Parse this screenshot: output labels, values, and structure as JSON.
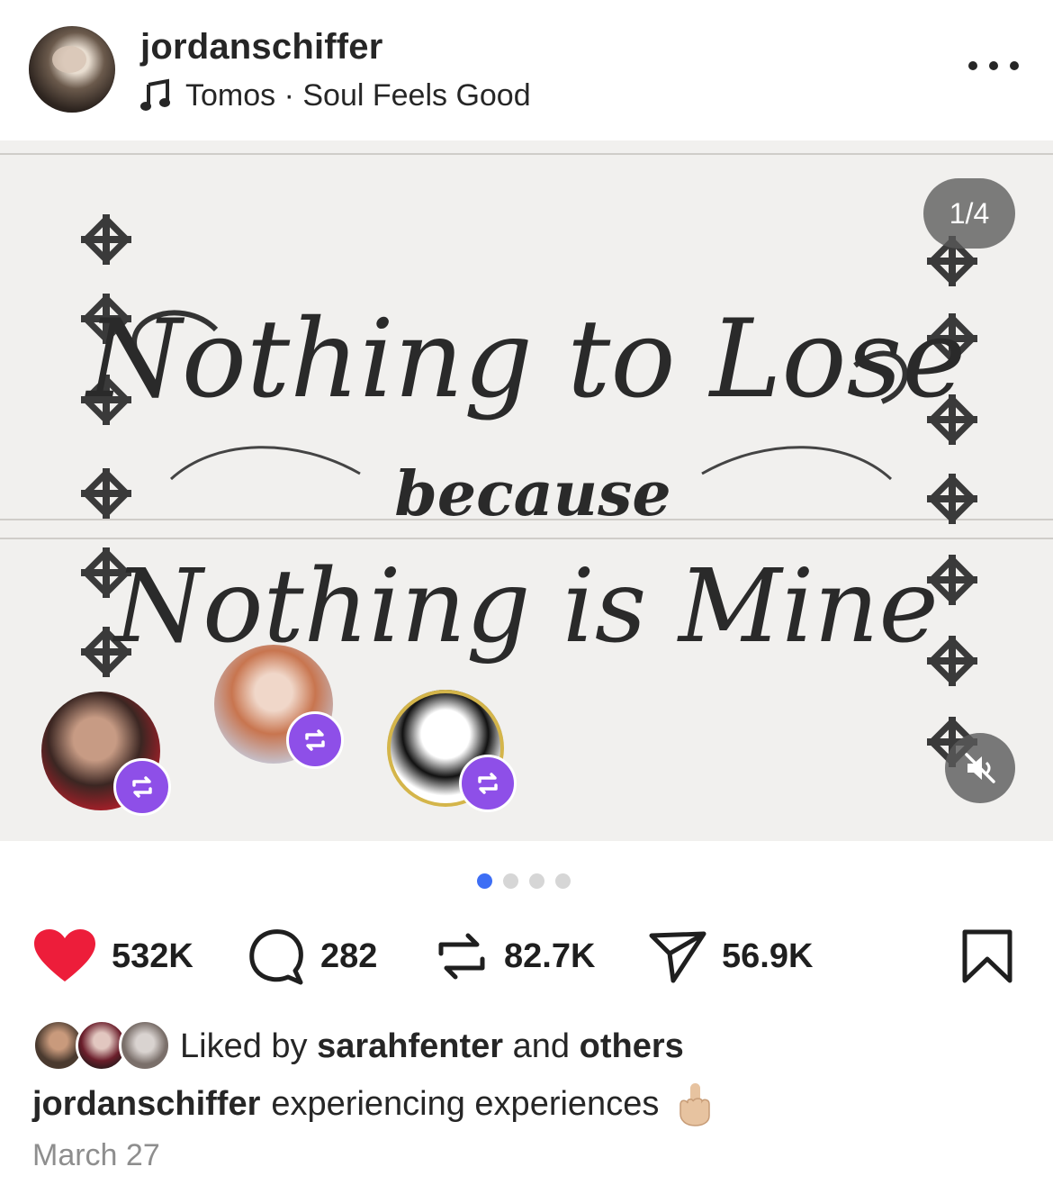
{
  "post": {
    "username": "jordanschiffer",
    "audio": "Tomos · Soul Feels Good",
    "more_icon": "more-horizontal-icon"
  },
  "media": {
    "counter": "1/4",
    "image_text": [
      "Nothing to Lose",
      "because",
      "Nothing is Mine"
    ],
    "mute_icon": "speaker-muted-icon",
    "slides_total": 4,
    "slide_active": 1,
    "repost_badge_color": "#8e4fe8"
  },
  "actions": {
    "like_count": "532K",
    "comment_count": "282",
    "repost_count": "82.7K",
    "share_count": "56.9K",
    "like_color": "#ed1d3a"
  },
  "likes": {
    "prefix": "Liked by",
    "user": "sarahfenter",
    "middle": "and",
    "others": "others"
  },
  "caption": {
    "username": "jordanschiffer",
    "text": "experiencing experiences",
    "emoji": "☝🏼"
  },
  "date": "March 27",
  "colors": {
    "accent_dot": "#3d6ef5",
    "text": "#262626",
    "muted": "#8e8e8e"
  }
}
